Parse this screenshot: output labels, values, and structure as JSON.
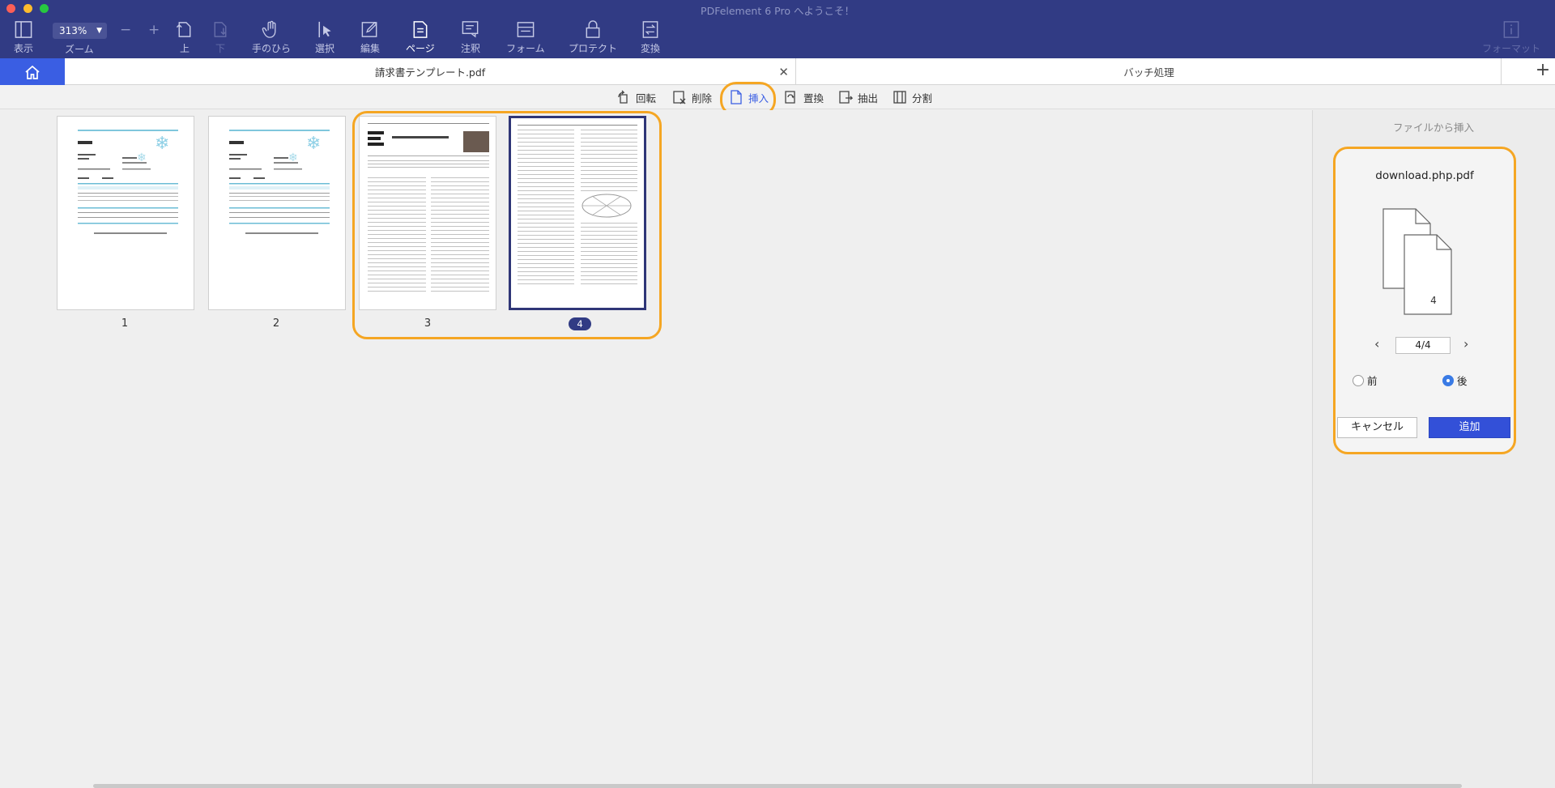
{
  "window": {
    "title": "PDFelement 6 Pro へようこそ！"
  },
  "toolbar": {
    "view_label": "表示",
    "zoom_value": "313%",
    "zoom_label": "ズーム",
    "zoom_out": "−",
    "zoom_in": "+",
    "up_label": "上",
    "down_label": "下",
    "hand_label": "手のひら",
    "select_label": "選択",
    "edit_label": "編集",
    "page_label": "ページ",
    "comment_label": "注釈",
    "form_label": "フォーム",
    "protect_label": "プロテクト",
    "convert_label": "変換",
    "format_label": "フォーマット"
  },
  "tabs": {
    "doc_tab": "請求書テンプレート.pdf",
    "close": "✕",
    "batch_tab": "バッチ処理",
    "new_tab": "+"
  },
  "page_tools": {
    "rotate": "回転",
    "delete": "削除",
    "insert": "挿入",
    "replace": "置換",
    "extract": "抽出",
    "split": "分割"
  },
  "pages": [
    {
      "number": "1"
    },
    {
      "number": "2"
    },
    {
      "number": "3"
    },
    {
      "number": "4"
    }
  ],
  "insert_panel": {
    "title": "ファイルから挿入",
    "file_name": "download.php.pdf",
    "preview_page": "4",
    "page_indicator": "4/4",
    "before_label": "前",
    "after_label": "後",
    "selected_position": "after",
    "cancel_label": "キャンセル",
    "add_label": "追加"
  },
  "colors": {
    "toolbar_bg": "#313b84",
    "accent_blue": "#3a5ee3",
    "highlight_orange": "#f5a623"
  }
}
